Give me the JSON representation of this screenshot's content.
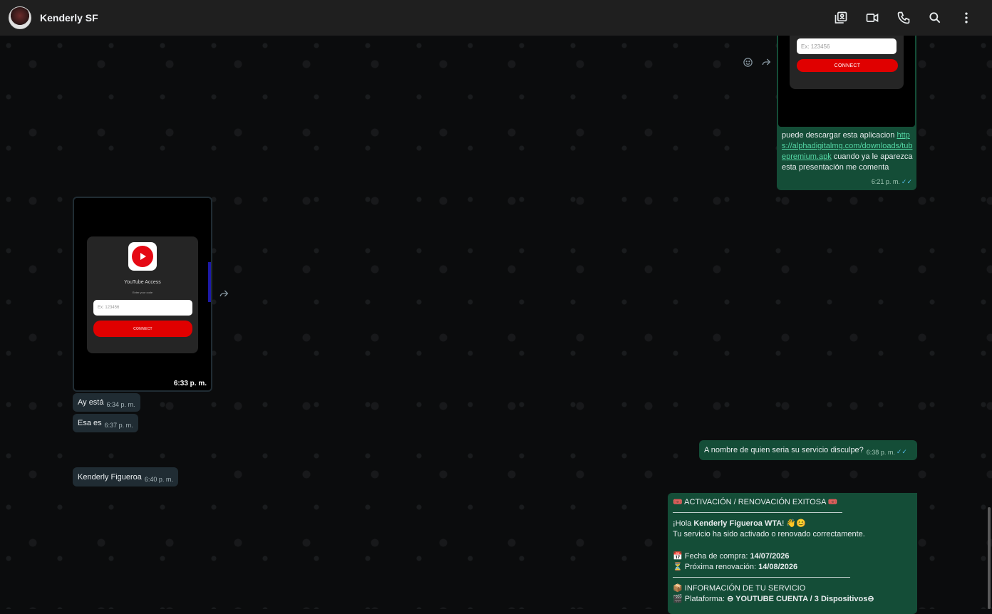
{
  "header": {
    "contact_name": "Kenderly SF",
    "actions": [
      "contacts-icon",
      "video-call-icon",
      "voice-call-icon",
      "search-icon",
      "menu-icon"
    ]
  },
  "app_preview_top": {
    "input_placeholder": "Ex: 123456",
    "connect_label": "CONNECT"
  },
  "msg_download": {
    "text_before": "puede descargar esta aplicacion",
    "link": "https://alphadigitalmg.com/downloads/tubepremium.apk",
    "text_after": "cuando ya le aparezca esta presentación me comenta",
    "time": "6:21 p. m."
  },
  "app_preview_image": {
    "title": "YouTube Access",
    "subtitle": "Enter your code",
    "input_placeholder": "Ex: 123456",
    "connect_label": "CONNECT",
    "time": "6:33 p. m."
  },
  "incoming": [
    {
      "text": "Ay está",
      "time": "6:34 p. m."
    },
    {
      "text": "Esa es",
      "time": "6:37 p. m."
    }
  ],
  "msg_question": {
    "text": "A nombre de quien seria su servicio disculpe?",
    "time": "6:38 p. m."
  },
  "msg_name": {
    "text": "Kenderly Figueroa",
    "time": "6:40 p. m."
  },
  "msg_activation": {
    "title": "ACTIVACIÓN / RENOVACIÓN EXITOSA",
    "greeting_prefix": "¡Hola ",
    "greeting_name": "Kenderly Figueroa WTA",
    "greeting_suffix": "!",
    "greeting_emoji": "👋😊",
    "line2": "Tu servicio ha sido activado o renovado correctamente.",
    "purchase_label": "Fecha de compra: ",
    "purchase_date": "14/07/2026",
    "renewal_label": "Próxima renovación: ",
    "renewal_date": "14/08/2026",
    "info_title": "INFORMACIÓN DE TU SERVICIO",
    "platform_label": "Plataforma: ",
    "platform_value": "YOUTUBE CUENTA / 3 Dispositivos"
  }
}
